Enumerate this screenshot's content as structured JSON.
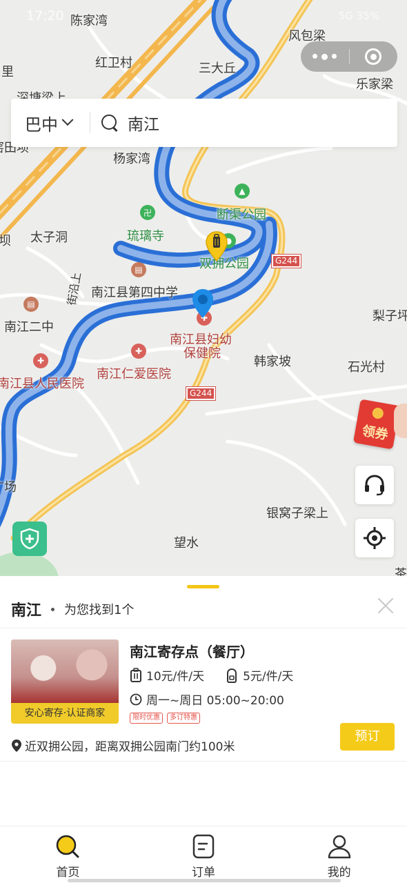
{
  "status_bar": {
    "time": "17:20",
    "right": "5G 35%"
  },
  "capsule": {
    "more_icon": "more-dots-icon",
    "close_icon": "target-close-icon"
  },
  "search": {
    "city": "巴中",
    "query": "南江"
  },
  "map": {
    "places": [
      {
        "id": "chenjiawan",
        "name": "陈家湾",
        "kind": "plain"
      },
      {
        "id": "fengbaoliang",
        "name": "风包梁",
        "kind": "plain"
      },
      {
        "id": "li",
        "name": "里",
        "kind": "plain"
      },
      {
        "id": "hongweicun",
        "name": "红卫村",
        "kind": "plain"
      },
      {
        "id": "sandaqiu",
        "name": "三大丘",
        "kind": "plain"
      },
      {
        "id": "lejialiang",
        "name": "乐家梁",
        "kind": "plain"
      },
      {
        "id": "shentangliang",
        "name": "深塘梁上",
        "kind": "plain"
      },
      {
        "id": "yaotianba",
        "name": "窑田坝",
        "kind": "plain"
      },
      {
        "id": "yangjiawan",
        "name": "杨家湾",
        "kind": "plain"
      },
      {
        "id": "duanqu",
        "name": "断渠公园",
        "kind": "green"
      },
      {
        "id": "liulisi",
        "name": "琉璃寺",
        "kind": "green"
      },
      {
        "id": "ba",
        "name": "坝",
        "kind": "plain"
      },
      {
        "id": "taizidong",
        "name": "太子洞",
        "kind": "plain"
      },
      {
        "id": "shuangyong",
        "name": "双拥公园",
        "kind": "green"
      },
      {
        "id": "disizhongxue",
        "name": "南江县第四中学",
        "kind": "plain"
      },
      {
        "id": "lizipo",
        "name": "梨子坪",
        "kind": "plain"
      },
      {
        "id": "erzhong",
        "name": "南江二中",
        "kind": "plain"
      },
      {
        "id": "fuyou",
        "name": "南江县妇幼",
        "kind": "red"
      },
      {
        "id": "fuyou2",
        "name": "保健院",
        "kind": "red"
      },
      {
        "id": "hanjiapo",
        "name": "韩家坡",
        "kind": "plain"
      },
      {
        "id": "shiguangcun",
        "name": "石光村",
        "kind": "plain"
      },
      {
        "id": "renmin",
        "name": "南江县人民医院",
        "kind": "red"
      },
      {
        "id": "renai",
        "name": "南江仁爱医院",
        "kind": "red"
      },
      {
        "id": "guangchang",
        "name": "广场",
        "kind": "plain"
      },
      {
        "id": "yinwozi",
        "name": "银窝子梁上",
        "kind": "plain"
      },
      {
        "id": "wangshui",
        "name": "望水",
        "kind": "plain"
      },
      {
        "id": "cha",
        "name": "茶",
        "kind": "plain"
      },
      {
        "id": "street",
        "name": "街沿上",
        "kind": "plain"
      }
    ],
    "road_shields": [
      "G244",
      "G244"
    ],
    "coupon_label": "领券"
  },
  "panel": {
    "title": "南江",
    "count_text": "为您找到1个"
  },
  "store": {
    "name": "南江寄存点（餐厅）",
    "thumb_tag": "安心寄存·认证商家",
    "price_large": "10元/件/天",
    "price_small": "5元/件/天",
    "hours": "周一~周日 05:00~20:00",
    "badges": [
      "限时优惠",
      "多订特惠"
    ],
    "address": "近双拥公园，距离双拥公园南门约100米",
    "book_label": "预订"
  },
  "tabs": [
    {
      "label": "首页",
      "icon": "search-home-icon",
      "active": true
    },
    {
      "label": "订单",
      "icon": "order-list-icon",
      "active": false
    },
    {
      "label": "我的",
      "icon": "user-profile-icon",
      "active": false
    }
  ],
  "colors": {
    "accent": "#F5CB19",
    "river": "#2A6FD6",
    "road": "#F4C455",
    "pin_blue": "#1E8CE6"
  }
}
